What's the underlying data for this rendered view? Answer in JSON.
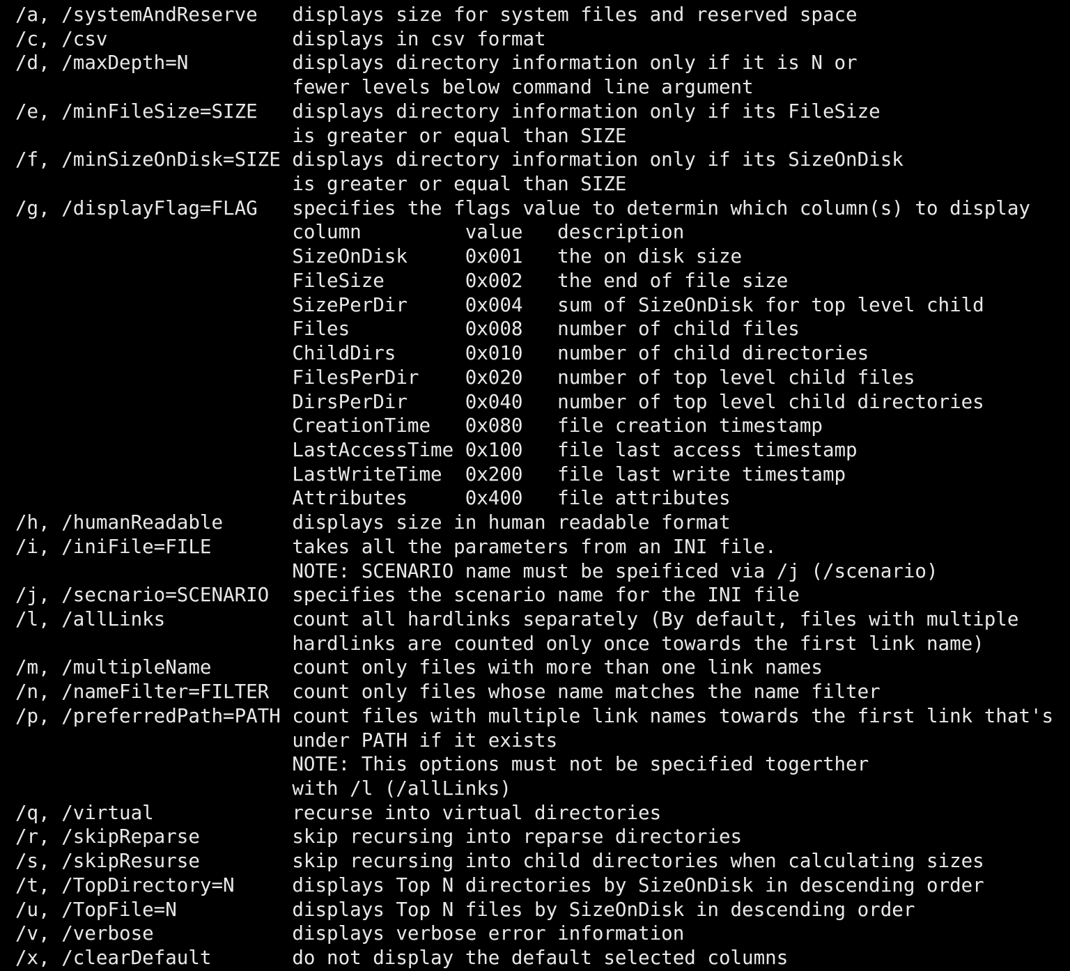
{
  "terminal": {
    "type": "console-help-output",
    "background_color": "#000000",
    "foreground_color": "#e8e8e8",
    "font": "monospace",
    "columns": 86,
    "option_column_width": 24,
    "lines": [
      "/a, /systemAndReserve   displays size for system files and reserved space",
      "/c, /csv                displays in csv format",
      "/d, /maxDepth=N         displays directory information only if it is N or",
      "                        fewer levels below command line argument",
      "/e, /minFileSize=SIZE   displays directory information only if its FileSize",
      "                        is greater or equal than SIZE",
      "/f, /minSizeOnDisk=SIZE displays directory information only if its SizeOnDisk",
      "                        is greater or equal than SIZE",
      "/g, /displayFlag=FLAG   specifies the flags value to determin which column(s) to display",
      "                        column         value   description",
      "                        SizeOnDisk     0x001   the on disk size",
      "                        FileSize       0x002   the end of file size",
      "                        SizePerDir     0x004   sum of SizeOnDisk for top level child",
      "                        Files          0x008   number of child files",
      "                        ChildDirs      0x010   number of child directories",
      "                        FilesPerDir    0x020   number of top level child files",
      "                        DirsPerDir     0x040   number of top level child directories",
      "                        CreationTime   0x080   file creation timestamp",
      "                        LastAccessTime 0x100   file last access timestamp",
      "                        LastWriteTime  0x200   file last write timestamp",
      "                        Attributes     0x400   file attributes",
      "/h, /humanReadable      displays size in human readable format",
      "/i, /iniFile=FILE       takes all the parameters from an INI file.",
      "                        NOTE: SCENARIO name must be speificed via /j (/scenario)",
      "/j, /secnario=SCENARIO  specifies the scenario name for the INI file",
      "/l, /allLinks           count all hardlinks separately (By default, files with multiple",
      "                        hardlinks are counted only once towards the first link name)",
      "/m, /multipleName       count only files with more than one link names",
      "/n, /nameFilter=FILTER  count only files whose name matches the name filter",
      "/p, /preferredPath=PATH count files with multiple link names towards the first link that's",
      "                        under PATH if it exists",
      "                        NOTE: This options must not be specified togerther",
      "                        with /l (/allLinks)",
      "/q, /virtual            recurse into virtual directories",
      "/r, /skipReparse        skip recursing into reparse directories",
      "/s, /skipResurse        skip recursing into child directories when calculating sizes",
      "/t, /TopDirectory=N     displays Top N directories by SizeOnDisk in descending order",
      "/u, /TopFile=N          displays Top N files by SizeOnDisk in descending order",
      "/v, /verbose            displays verbose error information",
      "/x, /clearDefault       do not display the default selected columns"
    ],
    "options": [
      {
        "switch": "/a, /systemAndReserve",
        "description": "displays size for system files and reserved space"
      },
      {
        "switch": "/c, /csv",
        "description": "displays in csv format"
      },
      {
        "switch": "/d, /maxDepth=N",
        "description": "displays directory information only if it is N or fewer levels below command line argument"
      },
      {
        "switch": "/e, /minFileSize=SIZE",
        "description": "displays directory information only if its FileSize is greater or equal than SIZE"
      },
      {
        "switch": "/f, /minSizeOnDisk=SIZE",
        "description": "displays directory information only if its SizeOnDisk is greater or equal than SIZE"
      },
      {
        "switch": "/g, /displayFlag=FLAG",
        "description": "specifies the flags value to determin which column(s) to display"
      },
      {
        "switch": "/h, /humanReadable",
        "description": "displays size in human readable format"
      },
      {
        "switch": "/i, /iniFile=FILE",
        "description": "takes all the parameters from an INI file. NOTE: SCENARIO name must be speificed via /j (/scenario)"
      },
      {
        "switch": "/j, /secnario=SCENARIO",
        "description": "specifies the scenario name for the INI file"
      },
      {
        "switch": "/l, /allLinks",
        "description": "count all hardlinks separately (By default, files with multiple hardlinks are counted only once towards the first link name)"
      },
      {
        "switch": "/m, /multipleName",
        "description": "count only files with more than one link names"
      },
      {
        "switch": "/n, /nameFilter=FILTER",
        "description": "count only files whose name matches the name filter"
      },
      {
        "switch": "/p, /preferredPath=PATH",
        "description": "count files with multiple link names towards the first link that's under PATH if it exists NOTE: This options must not be specified togerther with /l (/allLinks)"
      },
      {
        "switch": "/q, /virtual",
        "description": "recurse into virtual directories"
      },
      {
        "switch": "/r, /skipReparse",
        "description": "skip recursing into reparse directories"
      },
      {
        "switch": "/s, /skipResurse",
        "description": "skip recursing into child directories when calculating sizes"
      },
      {
        "switch": "/t, /TopDirectory=N",
        "description": "displays Top N directories by SizeOnDisk in descending order"
      },
      {
        "switch": "/u, /TopFile=N",
        "description": "displays Top N files by SizeOnDisk in descending order"
      },
      {
        "switch": "/v, /verbose",
        "description": "displays verbose error information"
      },
      {
        "switch": "/x, /clearDefault",
        "description": "do not display the default selected columns"
      }
    ],
    "flag_table": {
      "headers": [
        "column",
        "value",
        "description"
      ],
      "rows": [
        {
          "column": "SizeOnDisk",
          "value": "0x001",
          "description": "the on disk size"
        },
        {
          "column": "FileSize",
          "value": "0x002",
          "description": "the end of file size"
        },
        {
          "column": "SizePerDir",
          "value": "0x004",
          "description": "sum of SizeOnDisk for top level child"
        },
        {
          "column": "Files",
          "value": "0x008",
          "description": "number of child files"
        },
        {
          "column": "ChildDirs",
          "value": "0x010",
          "description": "number of child directories"
        },
        {
          "column": "FilesPerDir",
          "value": "0x020",
          "description": "number of top level child files"
        },
        {
          "column": "DirsPerDir",
          "value": "0x040",
          "description": "number of top level child directories"
        },
        {
          "column": "CreationTime",
          "value": "0x080",
          "description": "file creation timestamp"
        },
        {
          "column": "LastAccessTime",
          "value": "0x100",
          "description": "file last access timestamp"
        },
        {
          "column": "LastWriteTime",
          "value": "0x200",
          "description": "file last write timestamp"
        },
        {
          "column": "Attributes",
          "value": "0x400",
          "description": "file attributes"
        }
      ]
    }
  }
}
